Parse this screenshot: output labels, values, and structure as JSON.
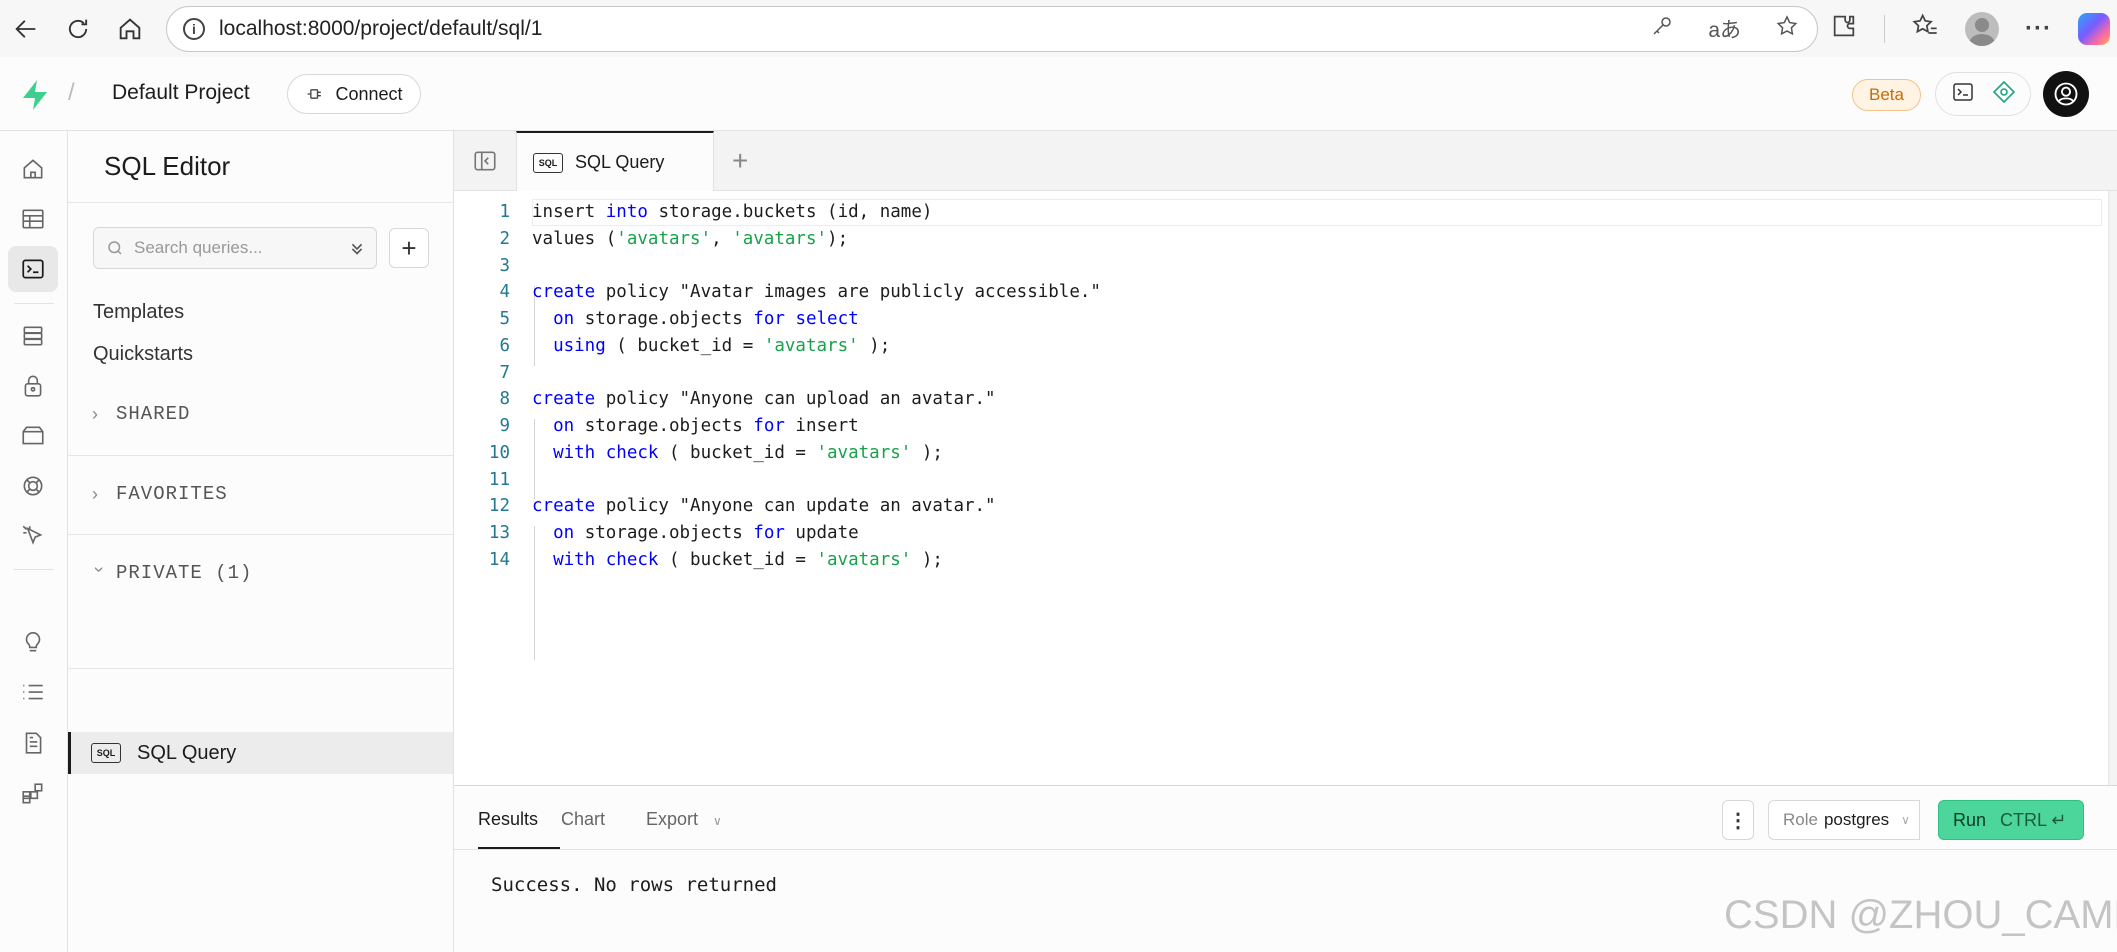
{
  "browser": {
    "url": "localhost:8000/project/default/sql/1",
    "icons": [
      "back-icon",
      "refresh-icon",
      "home-icon",
      "info-icon",
      "key-icon",
      "translate-icon",
      "star-icon",
      "extensions-icon",
      "favorites-icon",
      "profile-icon",
      "more-icon",
      "copilot-icon"
    ]
  },
  "header": {
    "project_name": "Default Project",
    "slash": "/",
    "connect_label": "Connect",
    "beta_label": "Beta"
  },
  "sidebar": {
    "title": "SQL Editor",
    "search_placeholder": "Search queries...",
    "add_label": "+",
    "links": [
      "Templates",
      "Quickstarts"
    ],
    "sections": {
      "shared": "SHARED",
      "favorites": "FAVORITES",
      "private": "PRIVATE (1)"
    },
    "query_item": "SQL Query"
  },
  "tabs": {
    "active_label": "SQL Query",
    "chip": "SQL",
    "add": "+"
  },
  "editor": {
    "line_numbers": [
      "1",
      "2",
      "3",
      "4",
      "5",
      "6",
      "7",
      "8",
      "9",
      "10",
      "11",
      "12",
      "13",
      "14"
    ]
  },
  "results": {
    "tabs": [
      "Results",
      "Chart",
      "Export"
    ],
    "kebab": "⋮",
    "role_label": "Role",
    "role_value": "postgres",
    "run_label": "Run",
    "run_shortcut": "CTRL ↵",
    "message": "Success. No rows returned"
  },
  "watermark": "CSDN @ZHOU_CAMP",
  "colors": {
    "accent_green": "#3ecf8e",
    "run_button": "#4dd69b",
    "keyword": "#0000ff",
    "string": "#16a34a",
    "line_number": "#237893",
    "beta_bg": "#fff4e3"
  }
}
